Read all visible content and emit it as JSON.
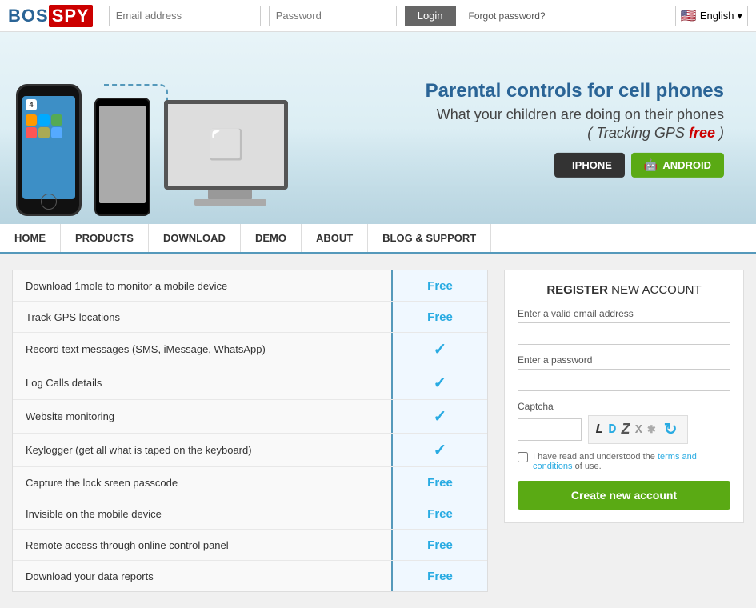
{
  "header": {
    "logo_bos": "BOS",
    "logo_spy": "SPY",
    "email_placeholder": "Email address",
    "password_placeholder": "Password",
    "login_label": "Login",
    "forgot_label": "Forgot password?",
    "lang_label": "English"
  },
  "hero": {
    "title": "Parental controls for cell phones",
    "subtitle": "What your children are doing on their phones",
    "gps_text": "( Tracking GPS",
    "gps_free": "free",
    "gps_close": ")",
    "iphone_label": "IPHONE",
    "android_label": "ANDROID"
  },
  "nav": {
    "items": [
      {
        "label": "HOME"
      },
      {
        "label": "PRODUCTS"
      },
      {
        "label": "DOWNLOAD"
      },
      {
        "label": "DEMO"
      },
      {
        "label": "ABOUT"
      },
      {
        "label": "BLOG & SUPPORT"
      }
    ]
  },
  "features": {
    "rows": [
      {
        "name": "Download 1mole to monitor a mobile device",
        "value": "Free",
        "type": "text"
      },
      {
        "name": "Track GPS locations",
        "value": "Free",
        "type": "text"
      },
      {
        "name": "Record text messages (SMS, iMessage, WhatsApp)",
        "value": "✓",
        "type": "check"
      },
      {
        "name": "Log Calls details",
        "value": "✓",
        "type": "check"
      },
      {
        "name": "Website monitoring",
        "value": "✓",
        "type": "check"
      },
      {
        "name": "Keylogger (get all what is taped on the keyboard)",
        "value": "✓",
        "type": "check"
      },
      {
        "name": "Capture the lock sreen passcode",
        "value": "Free",
        "type": "text"
      },
      {
        "name": "Invisible on the mobile device",
        "value": "Free",
        "type": "text"
      },
      {
        "name": "Remote access through online control panel",
        "value": "Free",
        "type": "text"
      },
      {
        "name": "Download your data reports",
        "value": "Free",
        "type": "text"
      }
    ]
  },
  "register": {
    "title_bold": "REGISTER",
    "title_rest": " NEW ACCOUNT",
    "email_label": "Enter a valid email address",
    "password_label": "Enter a password",
    "captcha_label": "Captcha",
    "captcha_letters": "L D Z X",
    "terms_text": "I have read and understood the",
    "terms_link": "terms and conditions",
    "terms_suffix": "of use.",
    "submit_label": "Create new account"
  }
}
